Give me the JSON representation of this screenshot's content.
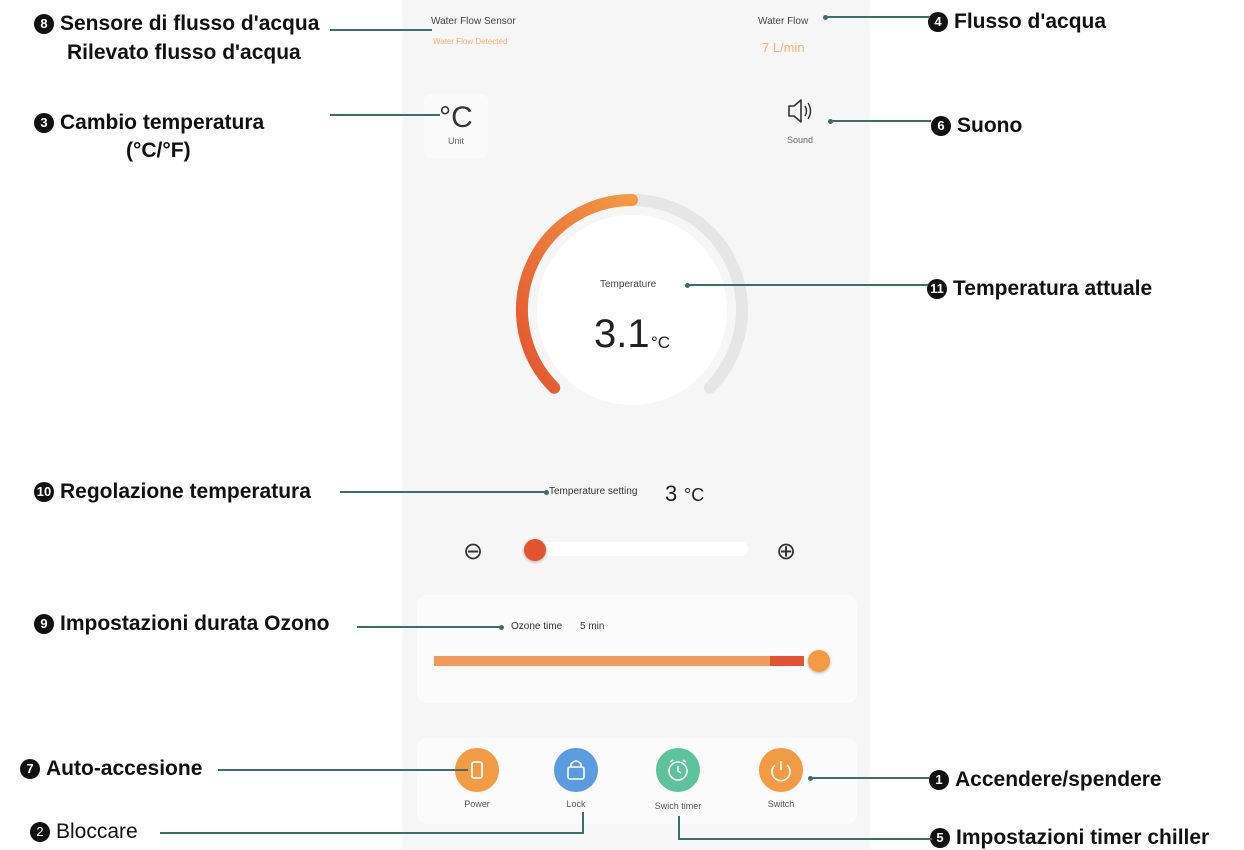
{
  "screen": {
    "water_flow_sensor": {
      "title": "Water Flow Sensor",
      "status": "Water Flow Detected"
    },
    "water_flow": {
      "title": "Water Flow",
      "value": "7 L/min"
    },
    "unit": {
      "symbol": "°C",
      "label": "Unit"
    },
    "sound": {
      "label": "Sound"
    },
    "gauge": {
      "label": "Temperature",
      "value": "3.1",
      "unit": "°C",
      "level": 0.5
    },
    "temp_setting": {
      "label": "Temperature setting",
      "value": "3",
      "unit": "°C",
      "minus": "⊖",
      "plus": "⊕",
      "slider_level": 0.0
    },
    "ozone": {
      "label": "Ozone time",
      "value": "5 min",
      "level": 1.0
    },
    "buttons": [
      {
        "label": "Power",
        "color": "#f39a44"
      },
      {
        "label": "Lock",
        "color": "#5b9be0"
      },
      {
        "label": "Swich timer",
        "color": "#5cc39c"
      },
      {
        "label": "Switch",
        "color": "#f39a44"
      }
    ]
  },
  "callouts": {
    "c8_title": "Sensore di flusso d'acqua",
    "c8_sub": "Rilevato flusso d'acqua",
    "c4": "Flusso d'acqua",
    "c3_title": "Cambio temperatura",
    "c3_sub": "(°C/°F)",
    "c6": "Suono",
    "c11": "Temperatura attuale",
    "c10": "Regolazione temperatura",
    "c9": "Impostazioni durata Ozono",
    "c7": "Auto-accesione",
    "c1": "Accendere/spendere",
    "c2": "Bloccare",
    "c5": "Impostazioni timer chiller",
    "numbers": {
      "n1": "1",
      "n2": "2",
      "n3": "3",
      "n4": "4",
      "n5": "5",
      "n6": "6",
      "n7": "7",
      "n8": "8",
      "n9": "9",
      "n10": "10",
      "n11": "11"
    }
  },
  "colors": {
    "accent_orange": "#f39a44",
    "accent_red": "#e4532f",
    "connector": "#3f6e66"
  }
}
